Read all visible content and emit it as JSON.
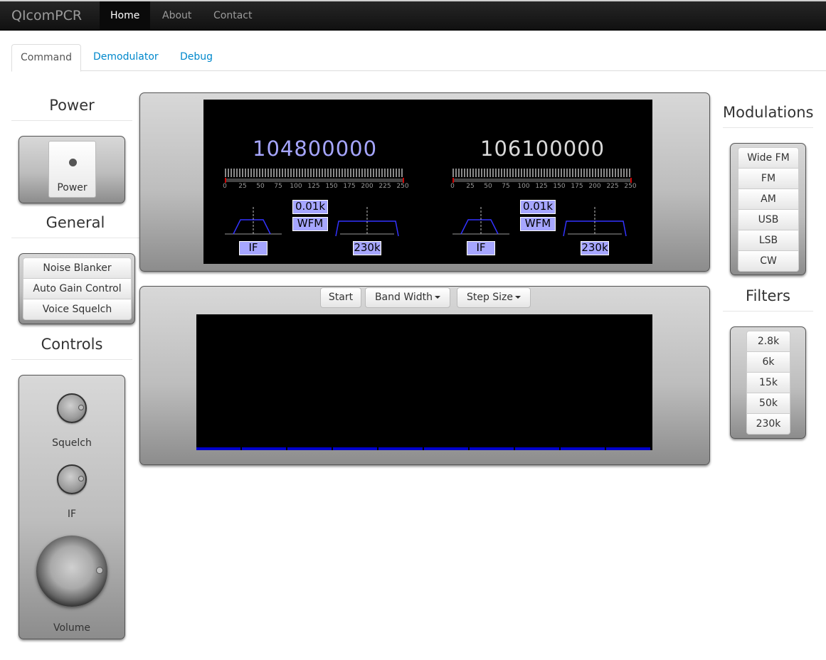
{
  "navbar": {
    "brand": "QIcomPCR",
    "items": [
      {
        "label": "Home"
      },
      {
        "label": "About"
      },
      {
        "label": "Contact"
      }
    ]
  },
  "tabs": [
    {
      "label": "Command"
    },
    {
      "label": "Demodulator"
    },
    {
      "label": "Debug"
    }
  ],
  "power": {
    "heading": "Power",
    "button_label": "Power"
  },
  "general": {
    "heading": "General",
    "buttons": [
      {
        "label": "Noise Blanker"
      },
      {
        "label": "Auto Gain Control"
      },
      {
        "label": "Voice Squelch"
      }
    ]
  },
  "controls": {
    "heading": "Controls",
    "squelch_label": "Squelch",
    "if_label": "IF",
    "volume_label": "Volume"
  },
  "display": {
    "left": {
      "frequency": "104800000",
      "freq_color": "#a6a6ff",
      "step": "0.01k",
      "mode": "WFM",
      "if_label": "IF",
      "bandwidth": "230k"
    },
    "right": {
      "frequency": "106100000",
      "freq_color": "#d9d9d9",
      "step": "0.01k",
      "mode": "WFM",
      "if_label": "IF",
      "bandwidth": "230k"
    },
    "scale_labels": [
      "0",
      "25",
      "50",
      "75",
      "100",
      "125",
      "150",
      "175",
      "200",
      "225",
      "250"
    ]
  },
  "spectrum": {
    "start_label": "Start",
    "bandwidth_label": "Band Width",
    "step_label": "Step Size"
  },
  "modulations": {
    "heading": "Modulations",
    "items": [
      {
        "label": "Wide FM"
      },
      {
        "label": "FM"
      },
      {
        "label": "AM"
      },
      {
        "label": "USB"
      },
      {
        "label": "LSB"
      },
      {
        "label": "CW"
      }
    ]
  },
  "filters": {
    "heading": "Filters",
    "items": [
      {
        "label": "2.8k"
      },
      {
        "label": "6k"
      },
      {
        "label": "15k"
      },
      {
        "label": "50k"
      },
      {
        "label": "230k"
      }
    ]
  },
  "colors": {
    "accent_link": "#0088cc",
    "lcd_blue": "#a6a6ff",
    "spectrum_baseline": "#0000cc"
  }
}
